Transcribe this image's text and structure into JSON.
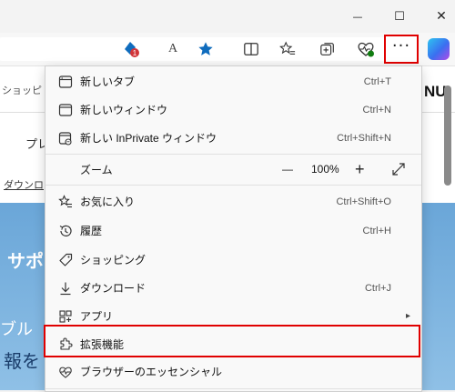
{
  "window": {
    "minimize_glyph": "—",
    "maximize_glyph": "☐",
    "close_glyph": "✕"
  },
  "toolbar": {
    "notification_count": "1",
    "read_aloud_label": "A",
    "more_glyph": "···"
  },
  "page": {
    "nav_text": "ショッピ",
    "brand_partial": "NU",
    "item_partial": "プレ",
    "download_partial": "ダウンロ",
    "hero_line1": "サポ",
    "hero_line2": "ブル",
    "hero_line3": "報を"
  },
  "menu": {
    "items": [
      {
        "label": "新しいタブ",
        "shortcut": "Ctrl+T",
        "icon": "new-tab-icon"
      },
      {
        "label": "新しいウィンドウ",
        "shortcut": "Ctrl+N",
        "icon": "new-window-icon"
      },
      {
        "label": "新しい InPrivate ウィンドウ",
        "shortcut": "Ctrl+Shift+N",
        "icon": "inprivate-icon"
      },
      {
        "label": "お気に入り",
        "shortcut": "Ctrl+Shift+O",
        "icon": "favorites-icon"
      },
      {
        "label": "履歴",
        "shortcut": "Ctrl+H",
        "icon": "history-icon"
      },
      {
        "label": "ショッピング",
        "shortcut": "",
        "icon": "shopping-tag-icon"
      },
      {
        "label": "ダウンロード",
        "shortcut": "Ctrl+J",
        "icon": "download-icon"
      },
      {
        "label": "アプリ",
        "shortcut": "",
        "icon": "apps-icon"
      },
      {
        "label": "拡張機能",
        "shortcut": "",
        "icon": "extensions-icon"
      },
      {
        "label": "ブラウザーのエッセンシャル",
        "shortcut": "",
        "icon": "browser-essentials-icon"
      }
    ],
    "zoom": {
      "label": "ズーム",
      "minus": "—",
      "value": "100%",
      "plus": "+",
      "fullscreen_icon": "expand-icon"
    },
    "apps_chevron": "▸"
  },
  "colors": {
    "highlight": "#e00000",
    "accent": "#0f6cbd"
  }
}
